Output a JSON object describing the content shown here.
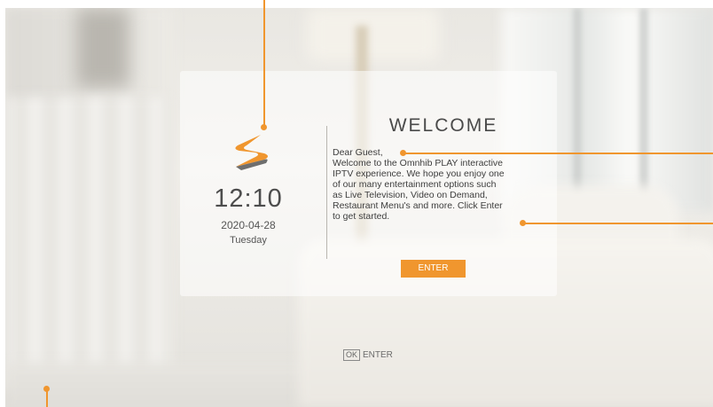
{
  "clock": {
    "time": "12:10",
    "date": "2020-04-28",
    "day": "Tuesday"
  },
  "welcome": {
    "title": "WELCOME",
    "message": "Dear Guest,\nWelcome to the Omnhib PLAY interactive\nIPTV experience. We hope you enjoy one\nof our many entertainment options such\nas Live Television, Video on Demand,\nRestaurant Menu's and more. Click Enter\nto get started.",
    "button_label": "ENTER"
  },
  "hint": {
    "key": "OK",
    "label": "ENTER"
  },
  "logo": {
    "icon": "omnhib-s-logo-icon"
  },
  "colors": {
    "accent": "#f0962e",
    "text": "#4a4a4a"
  }
}
